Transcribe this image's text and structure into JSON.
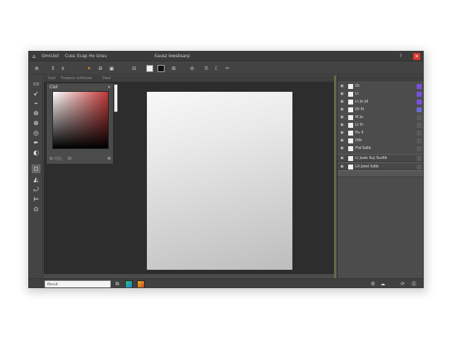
{
  "title_bar": {
    "app_icon": "app-icon",
    "menus": [
      "Omi",
      "Uiol",
      "Cuss",
      "Ecap",
      "Ho Unsu"
    ],
    "document_title": "Eausz Iowsbsarp",
    "help_label": "?",
    "close_label": "✕",
    "close_color": "#d9372a"
  },
  "options_bar": {
    "items": [
      {
        "name": "move-tool-icon",
        "label": "⊕"
      },
      {
        "name": "path-icon",
        "label": "↕"
      },
      {
        "name": "brush-option-icon",
        "label": "⩲"
      },
      {
        "name": "star-icon",
        "label": "✦"
      },
      {
        "name": "text-tool-icon",
        "label": "Ə"
      },
      {
        "name": "frame-icon",
        "label": "▣"
      },
      {
        "name": "align-icon",
        "label": "⊟"
      },
      {
        "name": "stack-icon",
        "label": "⊞"
      },
      {
        "name": "link-icon",
        "label": "⊘"
      },
      {
        "name": "chain-icon",
        "label": "ℬ"
      },
      {
        "name": "layer-toggle-icon",
        "label": "ℰ"
      },
      {
        "name": "cut-icon",
        "label": "✂"
      }
    ]
  },
  "tools": [
    {
      "name": "marquee-tool-icon",
      "label": "▭"
    },
    {
      "name": "lasso-tool-icon",
      "label": "↙"
    },
    {
      "name": "brush-tool-icon",
      "label": "⌁"
    },
    {
      "name": "stamp-tool-icon",
      "label": "⊛"
    },
    {
      "name": "history-tool-icon",
      "label": "⊗"
    },
    {
      "name": "blur-tool-icon",
      "label": "◎"
    },
    {
      "name": "pen-tool-icon",
      "label": "✒"
    },
    {
      "name": "dodge-tool-icon",
      "label": "◐"
    },
    {
      "name": "crop-tool-icon",
      "label": "⊡",
      "active": true
    },
    {
      "name": "gradient-tool-icon",
      "label": "◭"
    },
    {
      "name": "hand-tool-icon",
      "label": "⤾"
    },
    {
      "name": "zoom-tool-icon",
      "label": "⊨"
    },
    {
      "name": "rotate-tool-icon",
      "label": "⊙"
    }
  ],
  "doc_tabs": [
    "Iivor",
    "Tvopocc scthurse",
    "Daur"
  ],
  "color_panel": {
    "title": "Clot",
    "chevron": "▾",
    "hue_color": "#c23737",
    "foot_left": "⊙ ○○",
    "foot_mid": "⊡",
    "foot_right": "⊛"
  },
  "layers": [
    {
      "name": "Dl",
      "tag_color": "#7a4fe0"
    },
    {
      "name": "Ll",
      "tag_color": "#7a4fe0"
    },
    {
      "name": "Ll Jo Jd",
      "tag_color": "#7a4fe0"
    },
    {
      "name": "Dl Ill",
      "tag_color": "#6b6bd6"
    },
    {
      "name": "Ill Ju",
      "tag_color": "#5a5a5a"
    },
    {
      "name": "Ll Ill",
      "tag_color": "#5a5a5a"
    },
    {
      "name": "Pu ll",
      "tag_color": "#5a5a5a"
    },
    {
      "name": "Dlb",
      "tag_color": "#5a5a5a"
    },
    {
      "name": "Fld Sdlb",
      "tag_color": "#5a5a5a"
    }
  ],
  "layer_groups": [
    {
      "name": "Ll Jsab Suj Sudlb",
      "tag_color": "#5a5a5a"
    },
    {
      "name": "Lll Jsbd Sdlb",
      "tag_color": "#5a5a5a"
    }
  ],
  "status_bar": {
    "input_value": "Ebruit",
    "icons": [
      {
        "name": "window-icon",
        "label": "⧉"
      },
      {
        "name": "settings-icon",
        "label": "⚙"
      },
      {
        "name": "cloud-icon",
        "label": "☁"
      },
      {
        "name": "refresh-icon",
        "label": "⟳"
      },
      {
        "name": "help-icon",
        "label": "⓪"
      }
    ]
  }
}
